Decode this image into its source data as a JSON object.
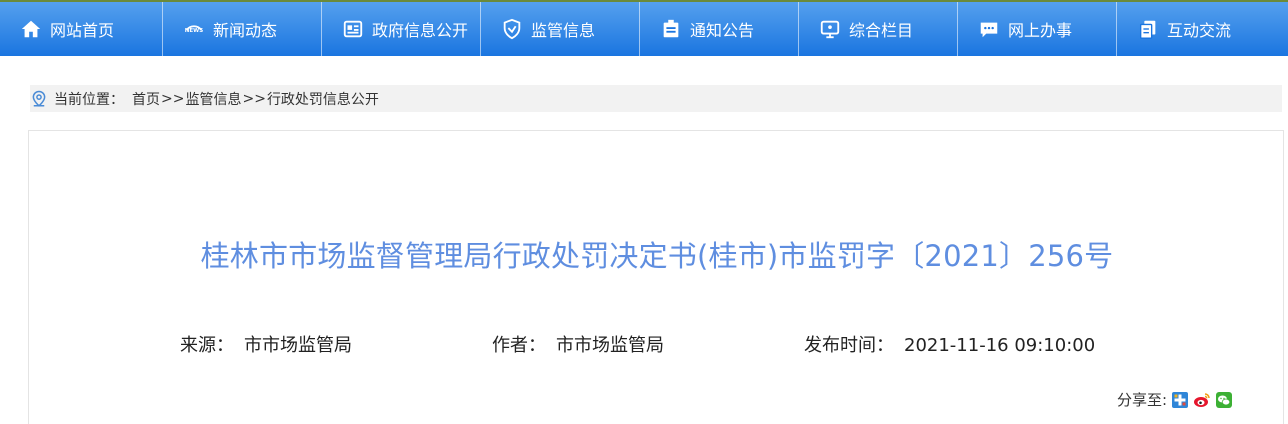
{
  "nav": {
    "items": [
      {
        "label": "网站首页",
        "icon": "home-icon"
      },
      {
        "label": "新闻动态",
        "icon": "news-icon"
      },
      {
        "label": "政府信息公开",
        "icon": "document-list-icon"
      },
      {
        "label": "监管信息",
        "icon": "shield-icon"
      },
      {
        "label": "通知公告",
        "icon": "clipboard-icon"
      },
      {
        "label": "综合栏目",
        "icon": "monitor-icon"
      },
      {
        "label": "网上办事",
        "icon": "chat-icon"
      },
      {
        "label": "互动交流",
        "icon": "copy-icon"
      }
    ],
    "colors": {
      "bg_top": "#55a0ee",
      "bg_bottom": "#1a75e0",
      "text": "#ffffff"
    }
  },
  "breadcrumb": {
    "prefix": "当前位置：",
    "items": [
      "首页",
      "监管信息",
      "行政处罚信息公开"
    ],
    "separator": ">>"
  },
  "article": {
    "title": "桂林市市场监督管理局行政处罚决定书(桂市)市监罚字〔2021〕256号",
    "title_color": "#5f8ee0",
    "source_label": "来源：",
    "source": "市市场监管局",
    "author_label": "作者：",
    "author": "市市场监管局",
    "date_label": "发布时间：",
    "date": "2021-11-16 09:10:00"
  },
  "share": {
    "label": "分享至:",
    "targets": [
      "qzone-plus-icon",
      "weibo-icon",
      "wechat-icon"
    ]
  }
}
